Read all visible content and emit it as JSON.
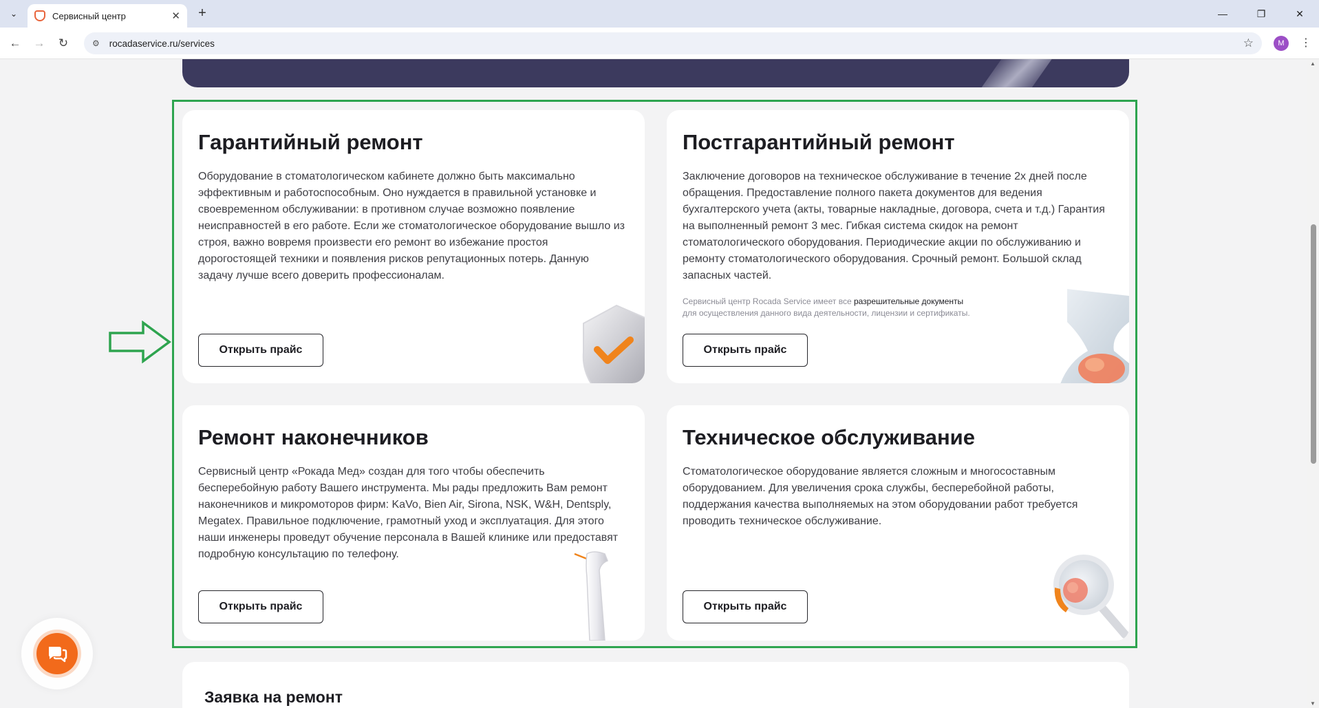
{
  "browser": {
    "tab_title": "Сервисный центр",
    "url": "rocadaservice.ru/services",
    "profile_initial": "M"
  },
  "services": [
    {
      "title": "Гарантийный ремонт",
      "description": "Оборудование в стоматологическом кабинете должно быть максимально эффективным и работоспособным. Оно нуждается в правильной установке и своевременном обслуживании: в противном случае возможно появление неисправностей в его работе. Если же стоматологическое оборудование вышло из строя, важно вовремя произвести его ремонт во избежание простоя дорогостоящей техники и появления рисков репутационных потерь. Данную задачу лучше всего доверить профессионалам.",
      "button": "Открыть прайс",
      "illustration": "shield-check-icon"
    },
    {
      "title": "Постгарантийный ремонт",
      "description": "Заключение договоров на техническое обслуживание в течение 2х дней после обращения. Предоставление полного пакета документов для ведения бухгалтерского учета (акты, товарные накладные, договора, счета и т.д.) Гарантия на выполненный ремонт 3 мес. Гибкая система скидок на ремонт стоматологического оборудования. Периодические акции по обслуживанию и ремонту стоматологического оборудования. Срочный ремонт. Большой склад запасных частей.",
      "note_prefix": "Сервисный центр Rocada Service имеет все",
      "note_link": "разрешительные документы",
      "note_suffix": "для осуществления данного вида деятельности, лицензии и сертификаты.",
      "button": "Открыть прайс",
      "illustration": "hourglass-icon"
    },
    {
      "title": "Ремонт наконечников",
      "description": "Сервисный центр «Рокада Мед» создан для того чтобы обеспечить бесперебойную работу Вашего инструмента. Мы рады предложить Вам ремонт наконечников и микромоторов фирм: KaVo, Bien Air, Sirona, NSK, W&H, Dentsply, Megatex. Правильное подключение, грамотный уход и эксплуатация. Для этого наши инженеры проведут обучение персонала в Вашей клинике или предоставят подробную консультацию по телефону.",
      "button": "Открыть прайс",
      "illustration": "dental-handpiece-icon"
    },
    {
      "title": "Техническое обслуживание",
      "description": "Стоматологическое оборудование является сложным и многосоставным оборудованием. Для увеличения срока службы, бесперебойной работы, поддержания качества выполняемых на этом оборудовании работ требуется проводить техническое обслуживание.",
      "button": "Открыть прайс",
      "illustration": "magnifier-icon"
    }
  ],
  "request_section": {
    "title": "Заявка на ремонт"
  },
  "colors": {
    "accent_orange": "#f26a1b",
    "banner": "#3c3a5e",
    "highlight_green": "#2ea44f"
  }
}
